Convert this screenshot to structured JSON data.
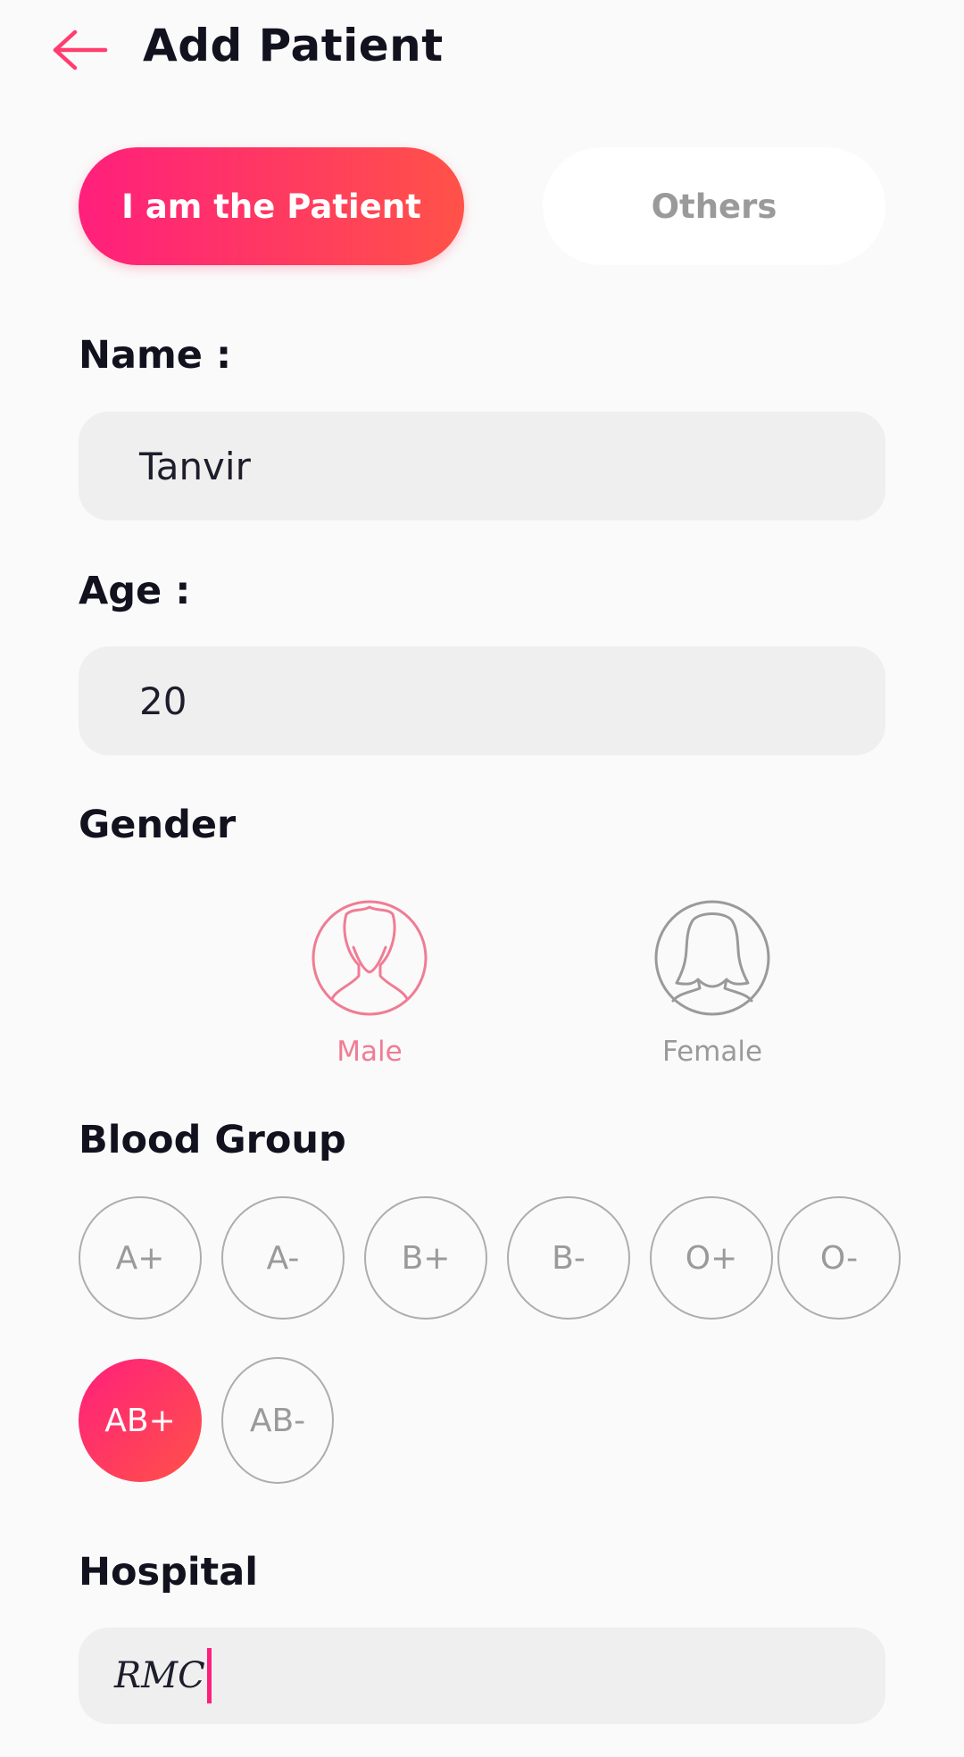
{
  "header": {
    "title": "Add Patient",
    "back_icon": "arrow-left-icon"
  },
  "patient_type": {
    "active": "I am the Patient",
    "inactive": "Others"
  },
  "name": {
    "label": "Name :",
    "value": "Tanvir"
  },
  "age": {
    "label": "Age :",
    "value": "20"
  },
  "gender": {
    "label": "Gender",
    "male": {
      "label": "Male",
      "icon": "male-avatar-icon"
    },
    "female": {
      "label": "Female",
      "icon": "female-avatar-icon"
    }
  },
  "blood_group": {
    "label": "Blood Group",
    "options": [
      "A+",
      "A-",
      "B+",
      "B-",
      "O+",
      "O-",
      "AB+",
      "AB-"
    ],
    "selected": "AB+"
  },
  "hospital": {
    "label": "Hospital",
    "value": "RMC"
  },
  "colors": {
    "accent_start": "#ff1f7c",
    "accent_end": "#ff5248",
    "male_icon": "#f07c94",
    "inactive": "#9a9a9a"
  }
}
